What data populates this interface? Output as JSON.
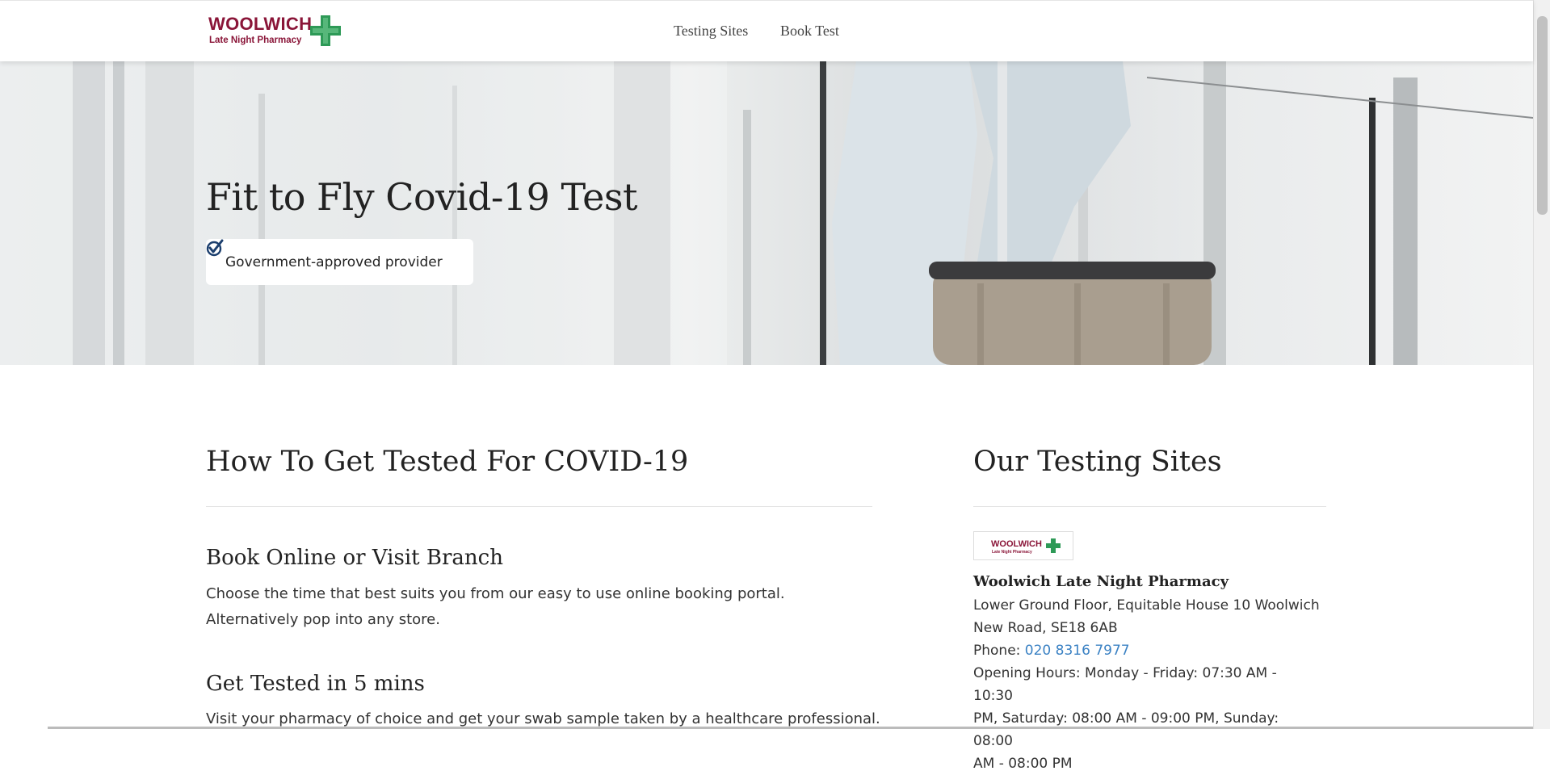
{
  "header": {
    "logo": {
      "name": "WOOLWICH",
      "tagline": "Late Night Pharmacy"
    },
    "nav": [
      "Testing Sites",
      "Book Test"
    ]
  },
  "hero": {
    "title": "Fit to Fly Covid-19 Test",
    "badge": "Government-approved provider"
  },
  "how_to": {
    "heading": "How To Get Tested For COVID-19",
    "steps": [
      {
        "title": "Book Online or Visit Branch",
        "lines": [
          "Choose the time that best suits you from our easy to use online booking portal.",
          "Alternatively pop into any store."
        ]
      },
      {
        "title": "Get Tested in 5 mins",
        "lines": [
          "Visit your pharmacy of choice and get your swab sample taken by a healthcare professional."
        ]
      }
    ]
  },
  "sites": {
    "heading": "Our Testing Sites",
    "logo": {
      "name": "WOOLWICH",
      "tagline": "Late Night Pharmacy"
    },
    "site": {
      "name": "Woolwich Late Night Pharmacy",
      "address_line1": "Lower Ground Floor, Equitable House 10 Woolwich",
      "address_line2": "New Road, SE18 6AB",
      "phone_label": "Phone:",
      "phone": "020 8316 7977",
      "hours_line1": "Opening Hours: Monday - Friday: 07:30 AM - 10:30",
      "hours_line2": "PM, Saturday: 08:00 AM - 09:00 PM, Sunday: 08:00",
      "hours_line3": "AM - 08:00 PM"
    }
  },
  "colors": {
    "brand": "#8a1538",
    "cross": "#2e9a57",
    "link": "#3b82c4"
  },
  "icons": {
    "badge": "checkmark-circle-icon",
    "logo": "green-cross-icon"
  }
}
